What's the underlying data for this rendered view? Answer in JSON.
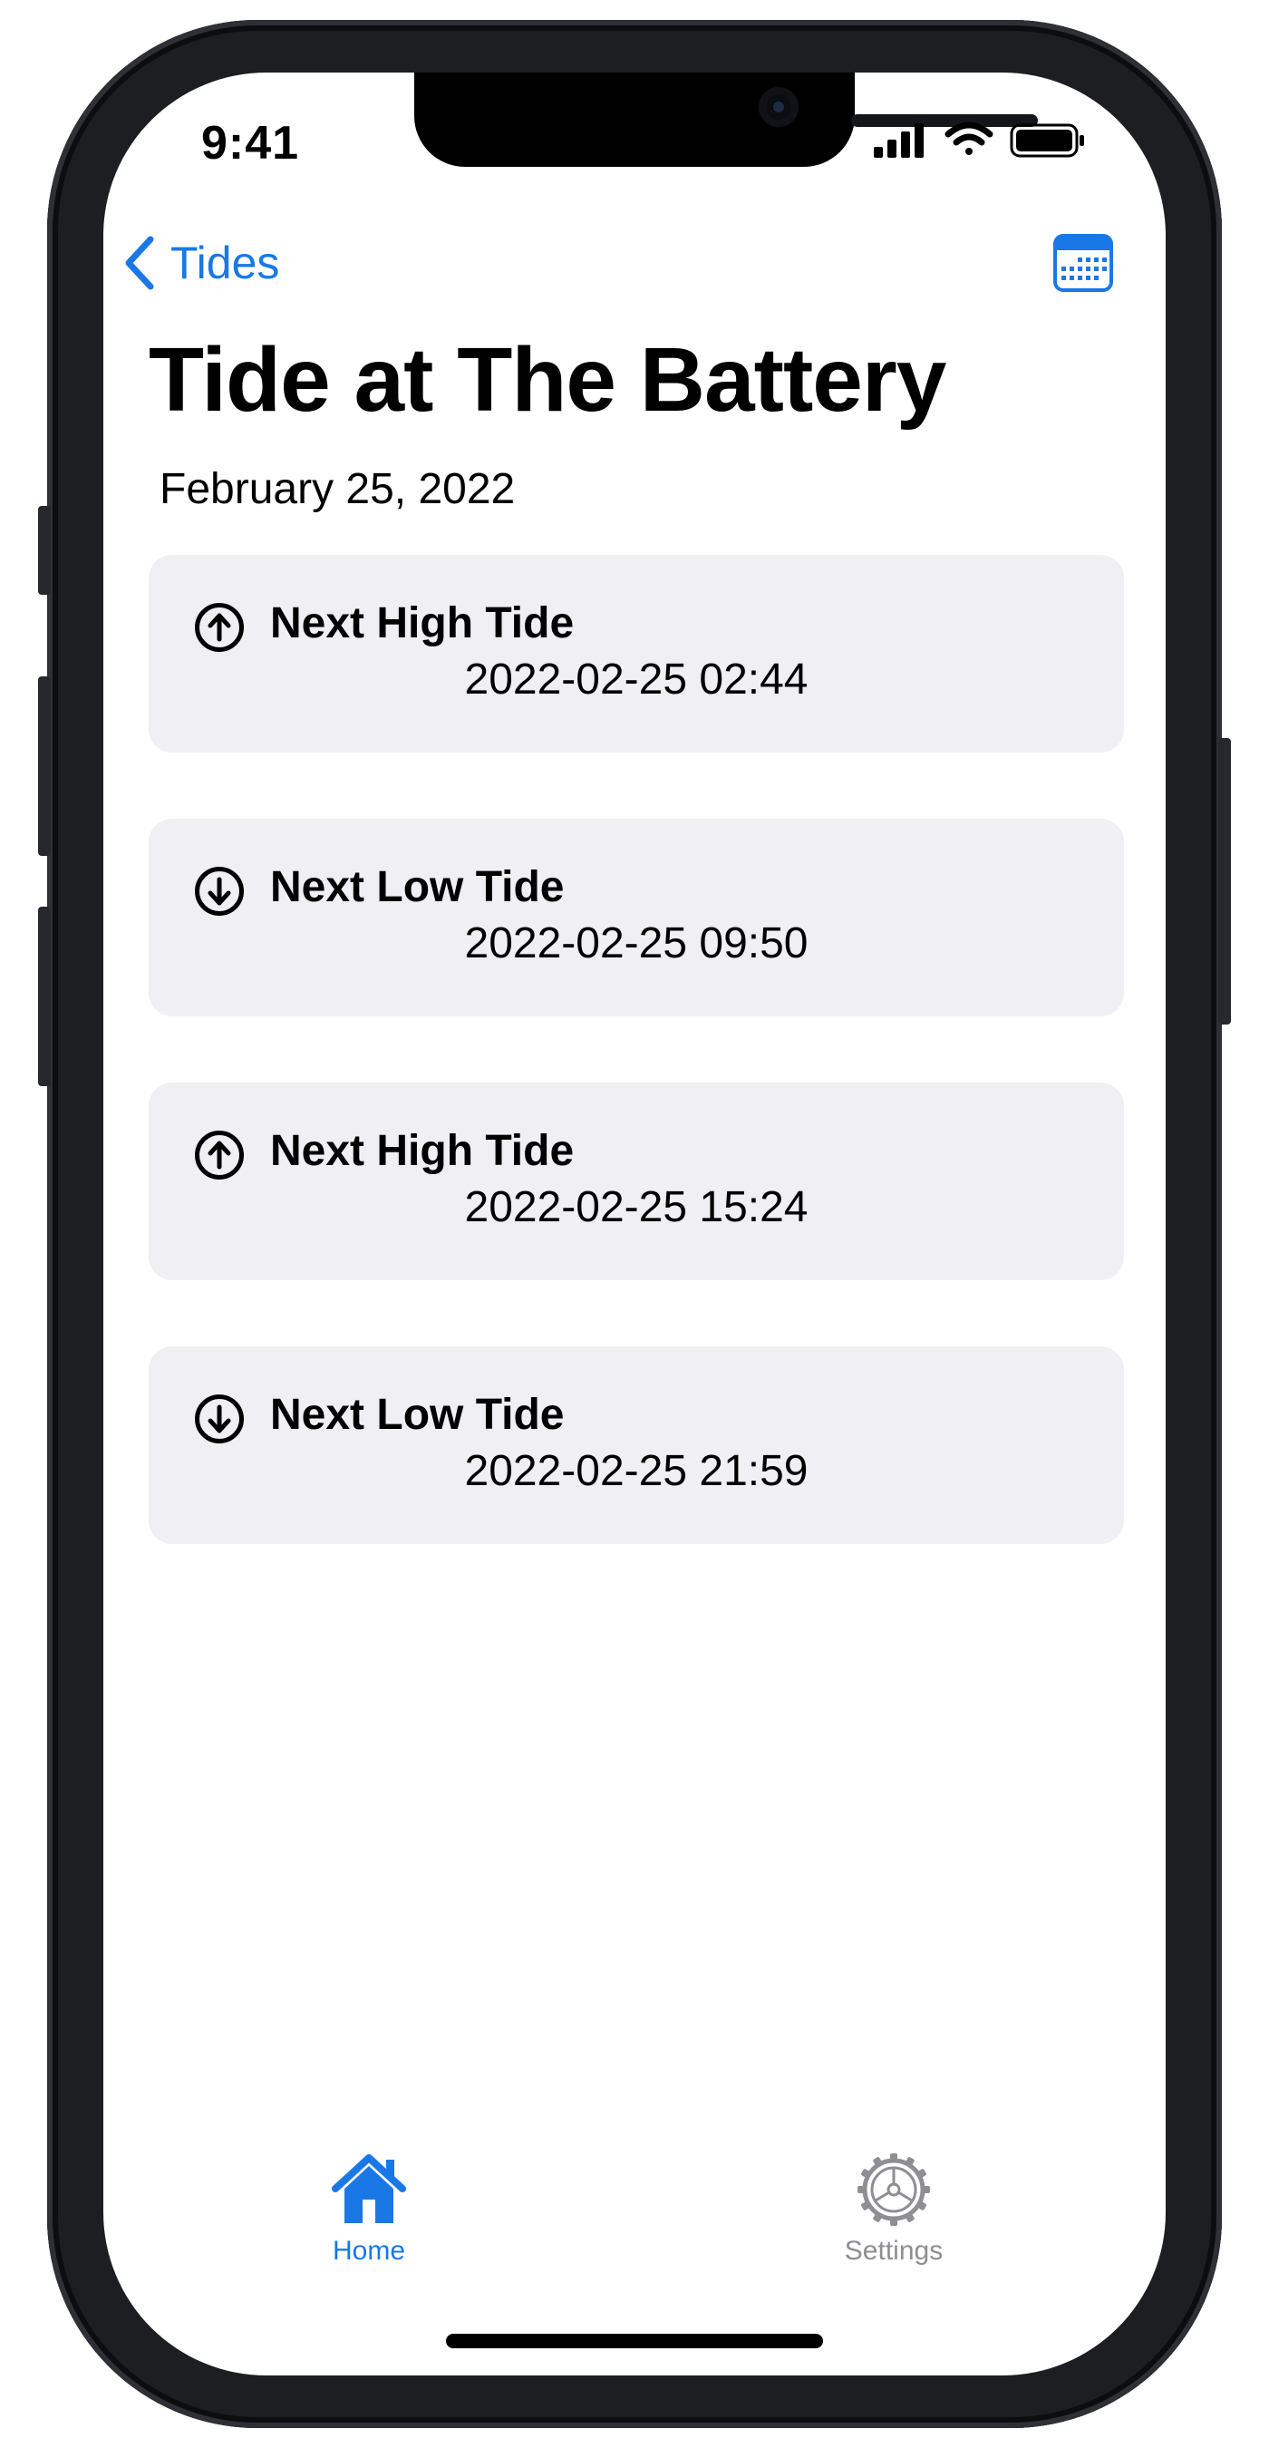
{
  "status_bar": {
    "time": "9:41"
  },
  "nav": {
    "back_label": "Tides",
    "calendar_icon": "calendar-icon"
  },
  "page": {
    "title": "Tide at The Battery",
    "date": "February 25, 2022"
  },
  "tides": [
    {
      "label": "Next High Tide",
      "time": "2022-02-25 02:44",
      "direction": "up",
      "icon": "arrow-up-circle-icon"
    },
    {
      "label": "Next Low Tide",
      "time": "2022-02-25 09:50",
      "direction": "down",
      "icon": "arrow-down-circle-icon"
    },
    {
      "label": "Next High Tide",
      "time": "2022-02-25 15:24",
      "direction": "up",
      "icon": "arrow-up-circle-icon"
    },
    {
      "label": "Next Low Tide",
      "time": "2022-02-25 21:59",
      "direction": "down",
      "icon": "arrow-down-circle-icon"
    }
  ],
  "tab_bar": {
    "tabs": [
      {
        "label": "Home",
        "icon": "house-icon",
        "selected": true
      },
      {
        "label": "Settings",
        "icon": "gear-icon",
        "selected": false
      }
    ]
  },
  "colors": {
    "accent": "#1a78e6",
    "card_background": "#efeff4",
    "inactive_tab": "#8e8e93"
  }
}
